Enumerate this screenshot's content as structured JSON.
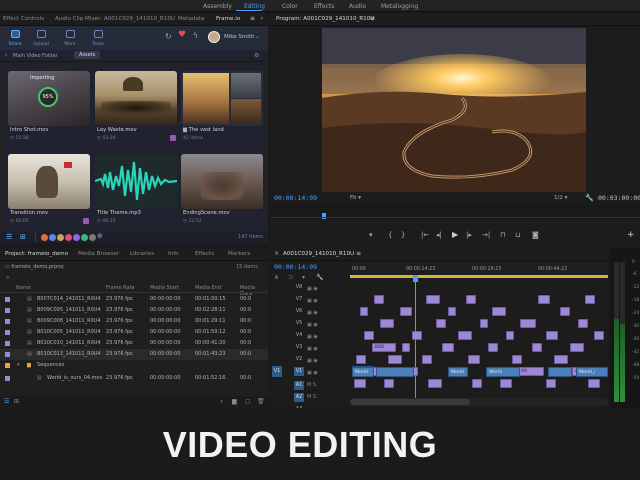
{
  "workspaces": [
    "Assembly",
    "Editing",
    "Color",
    "Effects",
    "Audio",
    "Metalogging"
  ],
  "workspace_active": "Editing",
  "left_tabs": [
    "Effect Controls",
    "Audio Clip Mixer: A001C029_141010_R10U",
    "Metadata",
    "Frame.io"
  ],
  "left_tab_active": "Frame.io",
  "frameio": {
    "tools": [
      "Share",
      "Upload",
      "More",
      "Team"
    ],
    "user": "Mike Smith",
    "breadcrumb": {
      "back": "Main Video Folder",
      "current": "Assets"
    },
    "cards": [
      {
        "name": "Intro Shot.mov",
        "meta": "15:38",
        "overlay": "Importing",
        "progress": "95%"
      },
      {
        "name": "Lay Waste.mov",
        "meta": "03:24"
      },
      {
        "name": "The vast land",
        "meta": "42 items"
      },
      {
        "name": "Transition.mov",
        "meta": "00:05"
      },
      {
        "name": "Title Theme.mp3",
        "meta": "06:15"
      },
      {
        "name": "EndingScene.mov",
        "meta": "22:52"
      }
    ],
    "items_count": "147 items"
  },
  "program": {
    "title": "Program: A001C029_141010_R10U",
    "timecode": "00:00:14:09",
    "fit": "Fit",
    "resolution": "1/2",
    "duration": "00:03:00:00"
  },
  "project": {
    "tabs": [
      "Project: frameio_demo",
      "Media Browser",
      "Libraries",
      "Info",
      "Effects",
      "Markers"
    ],
    "file": "frameio_demo.prproj",
    "count": "15 items",
    "columns": [
      "Name",
      "Frame Rate",
      "Media Start",
      "Media End",
      "Media Dura"
    ],
    "rows": [
      {
        "name": "B007C014_141011_R0U4",
        "fps": "23.976 fps",
        "start": "00:00:00:00",
        "end": "00:01:00:15",
        "dur": "00:0",
        "color": "#8f8fd8"
      },
      {
        "name": "B009C005_141011_R0U4",
        "fps": "23.976 fps",
        "start": "00:00:00:00",
        "end": "00:02:28:11",
        "dur": "00:0",
        "color": "#8f8fd8"
      },
      {
        "name": "B009C008_141011_R0U4",
        "fps": "23.976 fps",
        "start": "00:00:00:00",
        "end": "00:01:29:11",
        "dur": "00:0",
        "color": "#8f8fd8"
      },
      {
        "name": "B010C005_141011_R0U4",
        "fps": "23.976 fps",
        "start": "00:00:00:00",
        "end": "00:01:59:12",
        "dur": "00:0",
        "color": "#8f8fd8"
      },
      {
        "name": "B010C010_141011_R0U4",
        "fps": "23.976 fps",
        "start": "00:00:00:00",
        "end": "00:00:41:20",
        "dur": "00:0",
        "color": "#8f8fd8"
      },
      {
        "name": "B010C013_141011_R0U4",
        "fps": "23.976 fps",
        "start": "00:00:00:00",
        "end": "00:01:43:23",
        "dur": "00:0",
        "color": "#8f8fd8"
      },
      {
        "name": "Sequences",
        "fps": "",
        "start": "",
        "end": "",
        "dur": "",
        "color": "#e8a33a"
      },
      {
        "name": "World_is_ours_04.mov",
        "fps": "23.976 fps",
        "start": "00:00:00:00",
        "end": "00:01:52:16",
        "dur": "00:0",
        "color": "#8f8fd8"
      }
    ]
  },
  "timeline": {
    "title": "A001C029_141010_R10U",
    "timecode": "00:00:14:09",
    "ruler": [
      "00:00",
      "00:00:14:23",
      "00:00:29:23",
      "00:00:44:22"
    ],
    "video_tracks": [
      "V8",
      "V7",
      "V6",
      "V5",
      "V4",
      "V3",
      "V2",
      "V1"
    ],
    "audio_tracks": [
      "A1",
      "A2",
      "A3"
    ],
    "clip_labels": [
      "B00",
      "A0",
      "A0",
      "World",
      "World",
      "World",
      "World_i"
    ]
  },
  "meter_labels": [
    "0",
    "-6",
    "-12",
    "-18",
    "-24",
    "-30",
    "-36",
    "-42",
    "-48",
    "-54"
  ],
  "caption": "VIDEO EDITING"
}
